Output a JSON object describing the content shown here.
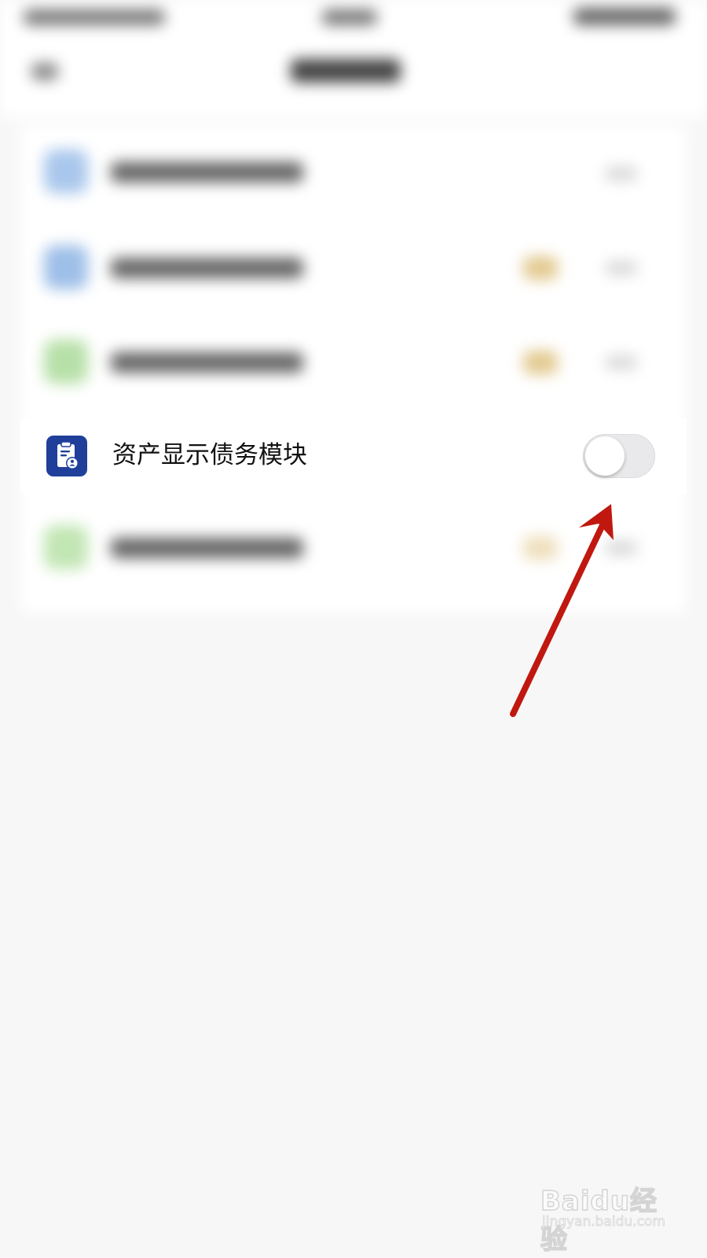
{
  "setting_row": {
    "label": "资产显示债务模块",
    "icon": "clipboard-user-icon",
    "toggle_on": false
  },
  "colors": {
    "icon_background": "#1f3f9a",
    "toggle_track": "#e9e9eb",
    "annotation_arrow": "#c0180f"
  },
  "watermark": {
    "logo": "Baidu经验",
    "url": "jingyan.baidu.com"
  }
}
